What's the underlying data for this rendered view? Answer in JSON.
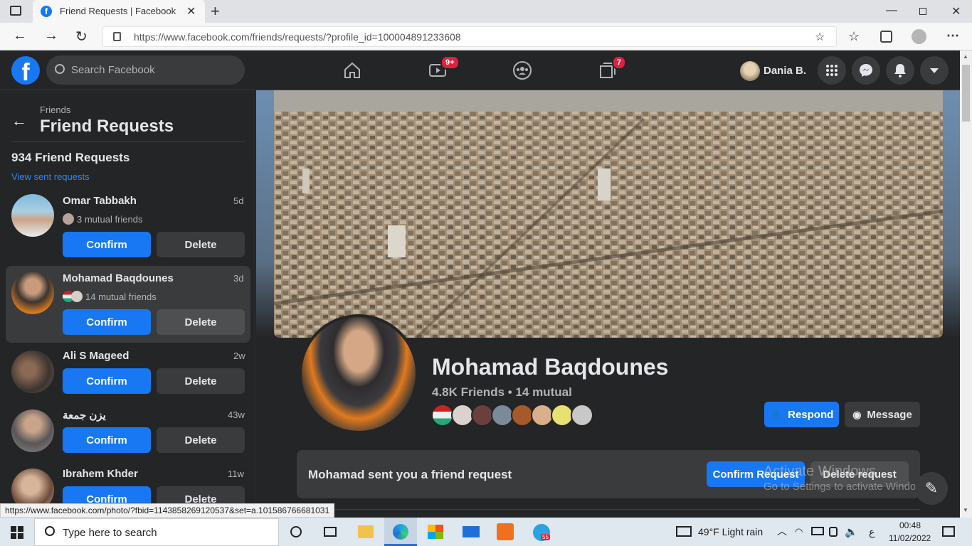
{
  "browser": {
    "tab_title": "Friend Requests | Facebook",
    "url": "https://www.facebook.com/friends/requests/?profile_id=100004891233608",
    "status_url": "https://www.facebook.com/photo/?fbid=114385826912053​7&set=a.101586766681031"
  },
  "header": {
    "search_placeholder": "Search Facebook",
    "watch_badge": "9+",
    "gaming_badge": "7",
    "user_name": "Dania B."
  },
  "sidebar": {
    "breadcrumb": "Friends",
    "title": "Friend Requests",
    "count_label": "934 Friend Requests",
    "view_sent": "View sent requests",
    "confirm_label": "Confirm",
    "delete_label": "Delete",
    "requests": [
      {
        "name": "Omar Tabbakh",
        "time": "5d",
        "mutual": "3 mutual friends"
      },
      {
        "name": "Mohamad Baqdounes",
        "time": "3d",
        "mutual": "14 mutual friends"
      },
      {
        "name": "Ali S Mageed",
        "time": "2w",
        "mutual": ""
      },
      {
        "name": "يزن جمعة",
        "time": "43w",
        "mutual": ""
      },
      {
        "name": "Ibrahem Khder",
        "time": "11w",
        "mutual": ""
      }
    ]
  },
  "profile": {
    "name": "Mohamad Baqdounes",
    "stats": "4.8K Friends • 14 mutual",
    "respond_label": "Respond",
    "message_label": "Message",
    "request_text": "Mohamad sent you a friend request",
    "confirm_request_label": "Confirm Request",
    "delete_request_label": "Delete request",
    "watermark_line1": "Activate Windows",
    "watermark_line2": "Go to Settings to activate Windows."
  },
  "taskbar": {
    "search_placeholder": "Type here to search",
    "weather": "49°F  Light rain",
    "lang": "ع",
    "time": "00:48",
    "date": "11/02/2022",
    "telegram_badge": "55"
  },
  "colors": {
    "accent": "#1877f2",
    "fb_bg": "#18191a",
    "fb_panel": "#242526",
    "badge": "#e41e3f"
  }
}
